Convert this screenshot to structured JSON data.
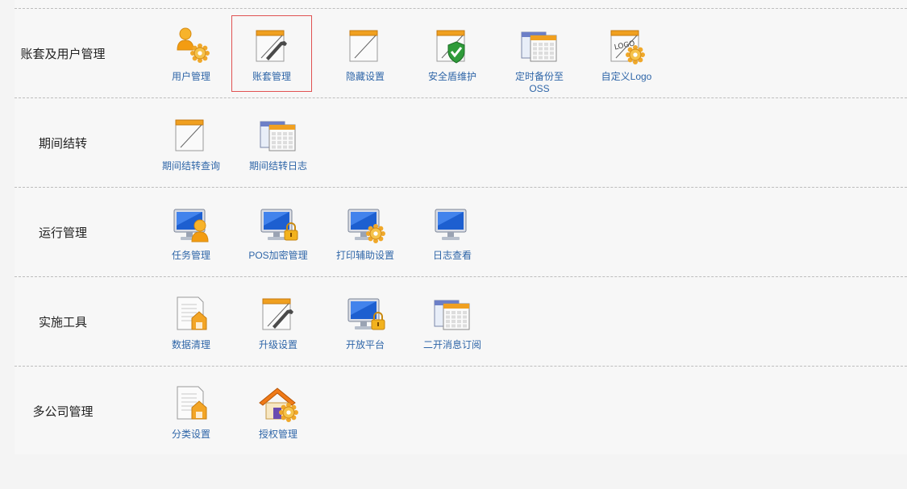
{
  "sections": [
    {
      "title": "账套及用户管理",
      "items": [
        {
          "label": "用户管理",
          "icon": "user-gear-icon"
        },
        {
          "label": "账套管理",
          "icon": "ledger-wrench-icon",
          "selected": true
        },
        {
          "label": "隐藏设置",
          "icon": "blank-page-icon"
        },
        {
          "label": "安全盾维护",
          "icon": "shield-check-icon"
        },
        {
          "label": "定时备份至\nOSS",
          "icon": "calendar-stack-icon"
        },
        {
          "label": "自定义Logo",
          "icon": "logo-gear-icon"
        }
      ]
    },
    {
      "title": "期间结转",
      "items": [
        {
          "label": "期间结转查询",
          "icon": "blank-page-icon"
        },
        {
          "label": "期间结转日志",
          "icon": "calendar-stack-icon"
        }
      ]
    },
    {
      "title": "运行管理",
      "items": [
        {
          "label": "任务管理",
          "icon": "monitor-user-icon"
        },
        {
          "label": "POS加密管理",
          "icon": "monitor-lock-icon"
        },
        {
          "label": "打印辅助设置",
          "icon": "monitor-gear-icon"
        },
        {
          "label": "日志查看",
          "icon": "monitor-icon"
        }
      ]
    },
    {
      "title": "实施工具",
      "items": [
        {
          "label": "数据清理",
          "icon": "document-box-icon"
        },
        {
          "label": "升级设置",
          "icon": "ledger-wrench-icon"
        },
        {
          "label": "开放平台",
          "icon": "monitor-lock-icon"
        },
        {
          "label": "二开消息订阅",
          "icon": "calendar-stack-icon"
        }
      ]
    },
    {
      "title": "多公司管理",
      "items": [
        {
          "label": "分类设置",
          "icon": "document-box-icon"
        },
        {
          "label": "授权管理",
          "icon": "house-gear-icon"
        }
      ]
    }
  ]
}
